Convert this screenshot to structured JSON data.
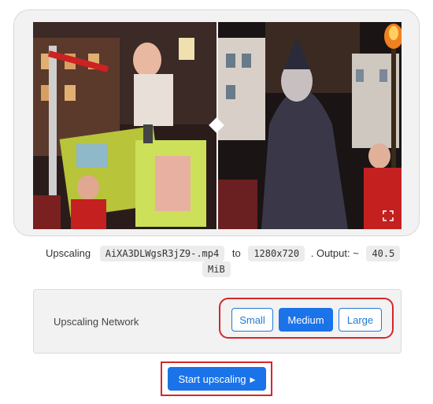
{
  "info": {
    "prefix": "Upscaling",
    "filename": "AiXA3DLWgsR3jZ9-.mp4",
    "to_label": "to",
    "resolution": "1280x720",
    "output_label": ". Output: ~",
    "output_size_part1": "40.5",
    "output_size_part2": "MiB"
  },
  "network": {
    "label": "Upscaling Network",
    "options": [
      "Small",
      "Medium",
      "Large"
    ],
    "selected": "Medium"
  },
  "start_button": {
    "label": "Start upscaling",
    "icon": "play-icon"
  },
  "preview": {
    "fullscreen_icon": "fullscreen-icon",
    "split_handle_icon": "diamond-handle-icon"
  },
  "colors": {
    "accent": "#1a73e8",
    "highlight": "#d7262c"
  }
}
